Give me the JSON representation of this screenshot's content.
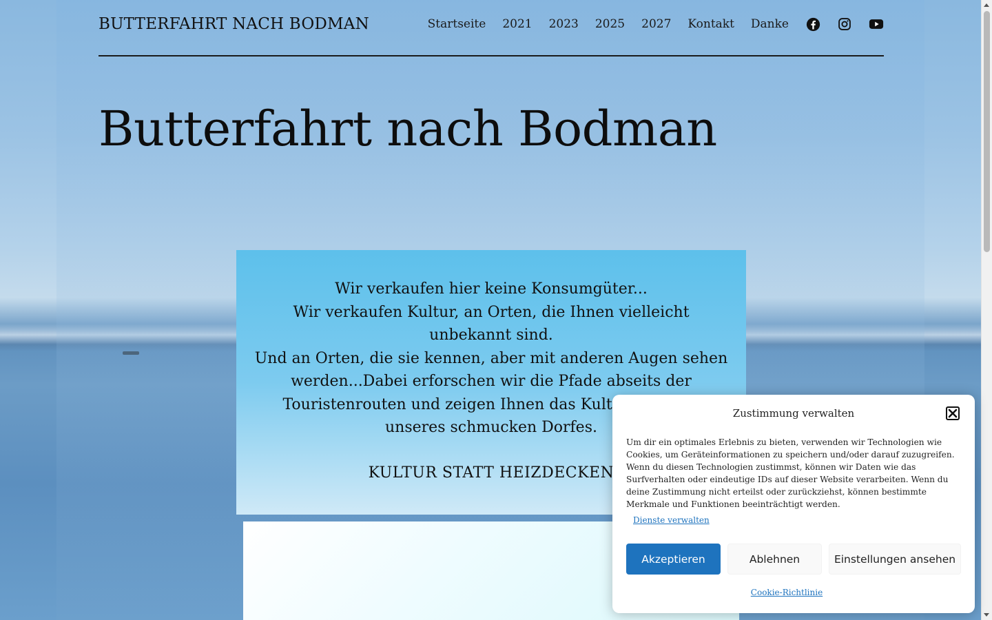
{
  "header": {
    "site_title": "BUTTERFAHRT NACH BODMAN",
    "nav": [
      {
        "label": "Startseite"
      },
      {
        "label": "2021"
      },
      {
        "label": "2023"
      },
      {
        "label": "2025"
      },
      {
        "label": "2027"
      },
      {
        "label": "Kontakt"
      },
      {
        "label": "Danke"
      }
    ],
    "social_icons": [
      "facebook-icon",
      "instagram-icon",
      "youtube-icon"
    ]
  },
  "hero": {
    "title": "Butterfahrt nach Bodman"
  },
  "quote": {
    "line1": "Wir verkaufen hier keine Konsumgüter...",
    "line2": "Wir verkaufen Kultur, an Orten, die Ihnen vielleicht unbekannt sind.",
    "line3": "Und an Orten, die sie kennen, aber mit anderen Augen sehen werden...Dabei erforschen wir die Pfade abseits der Touristenrouten und zeigen Ihnen das Kulturpotenzial unseres schmucken Dorfes.",
    "slogan": "KULTUR STATT HEIZDECKEN"
  },
  "cookie_banner": {
    "title": "Zustimmung verwalten",
    "text": "Um dir ein optimales Erlebnis zu bieten, verwenden wir Technologien wie Cookies, um Geräteinformationen zu speichern und/oder darauf zuzugreifen. Wenn du diesen Technologien zustimmst, können wir Daten wie das Surfverhalten oder eindeutige IDs auf dieser Website verarbeiten. Wenn du deine Zustimmung nicht erteilst oder zurückziehst, können bestimmte Merkmale und Funktionen beeinträchtigt werden.",
    "manage_services": "Dienste verwalten",
    "accept": "Akzeptieren",
    "deny": "Ablehnen",
    "view_preferences": "Einstellungen ansehen",
    "policy_link": "Cookie-Richtlinie",
    "accent_color": "#1e73be"
  }
}
